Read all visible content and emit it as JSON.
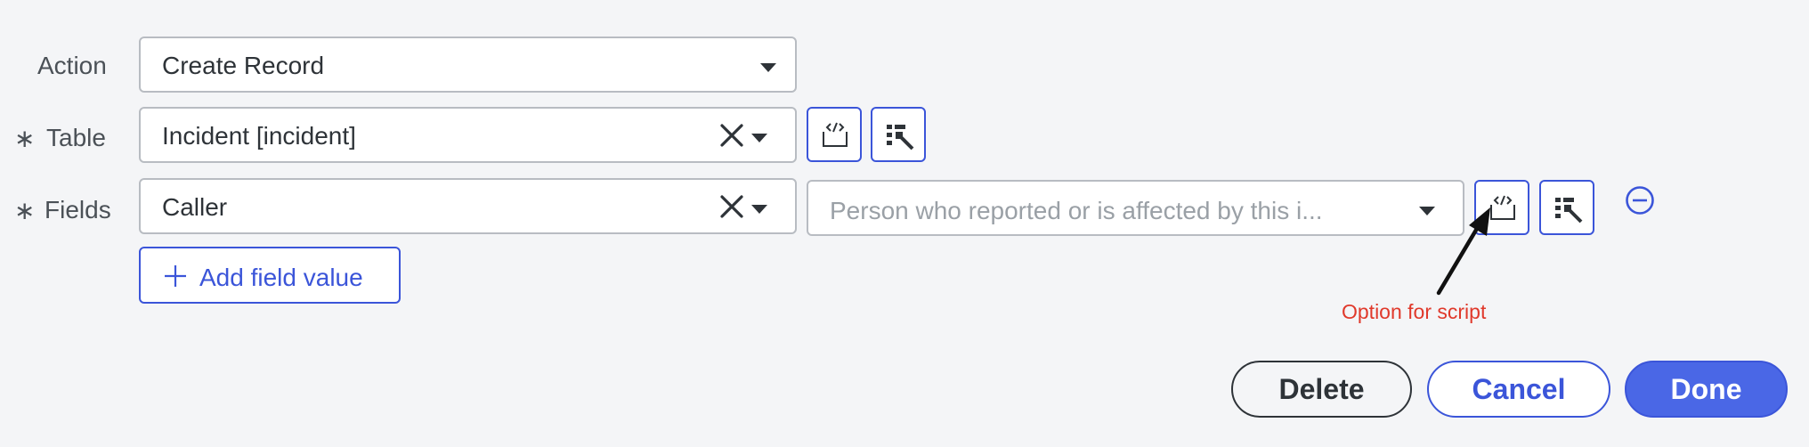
{
  "action": {
    "label": "Action",
    "value": "Create Record"
  },
  "table": {
    "required_mark": "∗",
    "label": "Table",
    "value": "Incident [incident]"
  },
  "fields": {
    "required_mark": "∗",
    "label": "Fields",
    "field_value": "Caller",
    "value_placeholder": "Person who reported or is affected by this i..."
  },
  "add_field_value": {
    "plus": "+",
    "label": "Add field value"
  },
  "annotation": {
    "text": "Option for script",
    "color": "#e0392b"
  },
  "footer": {
    "delete_label": "Delete",
    "cancel_label": "Cancel",
    "done_label": "Done"
  },
  "colors": {
    "accent": "#3b55d9",
    "done_bg": "#4a67e6",
    "background": "#f4f5f7"
  },
  "icons": {
    "script": "script-icon",
    "data_pill": "data-pill-picker-icon",
    "clear": "clear-x-icon",
    "dropdown": "chevron-down-icon",
    "remove": "minus-circle-icon"
  }
}
